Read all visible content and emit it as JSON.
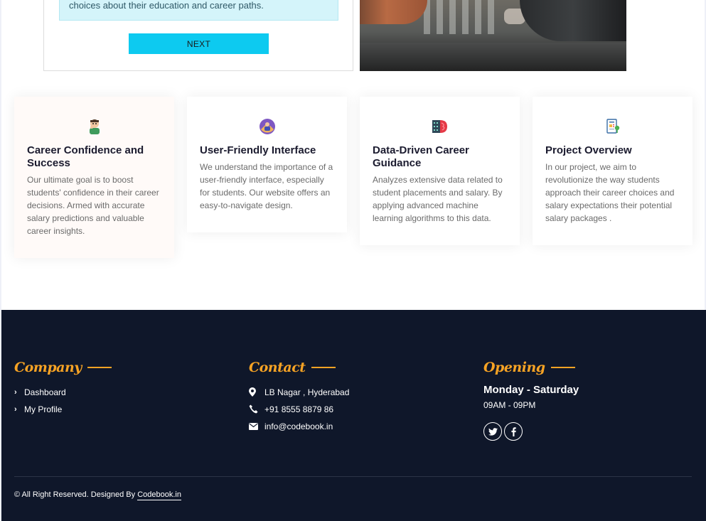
{
  "top": {
    "info_text": "choices about their education and career paths.",
    "next_label": "NEXT"
  },
  "cards": [
    {
      "icon": "student-thinking-icon",
      "title": "Career Confidence and Success",
      "text": "Our ultimate goal is to boost students' confidence in their career decisions. Armed with accurate salary predictions and valuable career insights."
    },
    {
      "icon": "user-interface-icon",
      "title": "User-Friendly Interface",
      "text": "We understand the importance of a user-friendly interface, especially for students. Our website offers an easy-to-navigate design."
    },
    {
      "icon": "data-brain-icon",
      "title": "Data-Driven Career Guidance",
      "text": "Analyzes extensive data related to student placements and salary. By applying advanced machine learning algorithms to this data."
    },
    {
      "icon": "project-overview-icon",
      "title": "Project Overview",
      "text": "In our project, we aim to revolutionize the way students approach their career choices and salary expectations their potential salary packages ."
    }
  ],
  "footer": {
    "company": {
      "heading": "Company",
      "links": [
        "Dashboard",
        "My Profile"
      ]
    },
    "contact": {
      "heading": "Contact",
      "address": "LB Nagar , Hyderabad",
      "phone": "+91 8555 8879 86",
      "email": "info@codebook.in"
    },
    "opening": {
      "heading": "Opening",
      "days": "Monday - Saturday",
      "hours": "09AM - 09PM"
    },
    "copyright_prefix": "© All Right Reserved. Designed By",
    "copyright_link": "Codebook.in"
  },
  "colors": {
    "accent": "#0dcaf0",
    "footer_bg": "#0f172a",
    "heading_orange": "#f7a324"
  }
}
